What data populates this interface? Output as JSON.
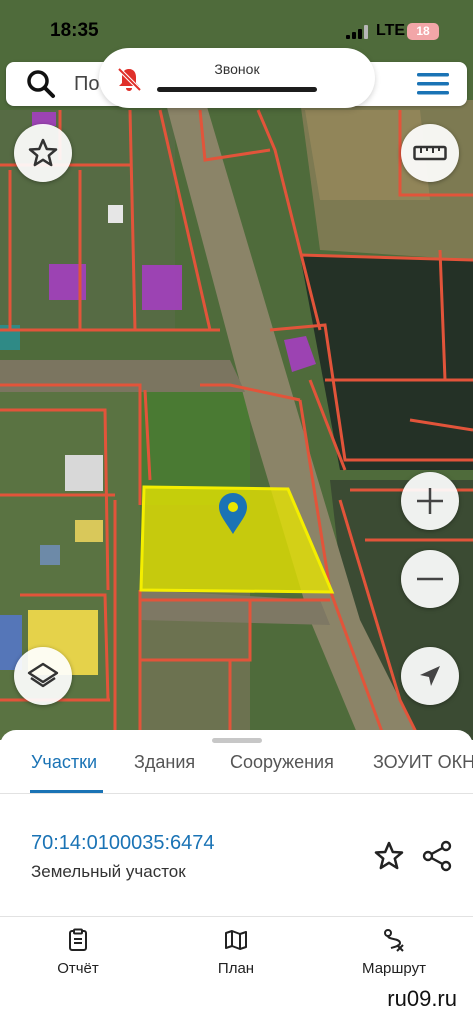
{
  "status_bar": {
    "time": "18:35",
    "network": "LTE",
    "battery": "18"
  },
  "call": {
    "label": "Звонок",
    "icon": "bell-slash-icon"
  },
  "search": {
    "text": "По",
    "icon": "search-icon",
    "menu_icon": "hamburger-menu-icon"
  },
  "map": {
    "parcel_fill": "#e8e600",
    "boundary_color": "#e2543a",
    "building_color": "#a43fc0",
    "pin_color": "#1a73b5"
  },
  "map_controls": {
    "favorite": "star-icon",
    "ruler": "ruler-icon",
    "zoom_in": "plus-icon",
    "zoom_out": "minus-icon",
    "layers": "layers-icon",
    "locate": "location-arrow-icon"
  },
  "sheet": {
    "tabs": [
      {
        "label": "Участки",
        "active": true
      },
      {
        "label": "Здания",
        "active": false
      },
      {
        "label": "Сооружения",
        "active": false
      },
      {
        "label": "ЗОУИТ ОКН",
        "active": false
      }
    ],
    "parcel": {
      "cadastral_number": "70:14:0100035:6474",
      "type": "Земельный участок"
    }
  },
  "bottom_nav": [
    {
      "label": "Отчёт",
      "icon": "report-icon"
    },
    {
      "label": "План",
      "icon": "map-icon"
    },
    {
      "label": "Маршрут",
      "icon": "route-icon"
    }
  ],
  "watermark": "ru09.ru",
  "colors": {
    "accent": "#1a73b5"
  }
}
